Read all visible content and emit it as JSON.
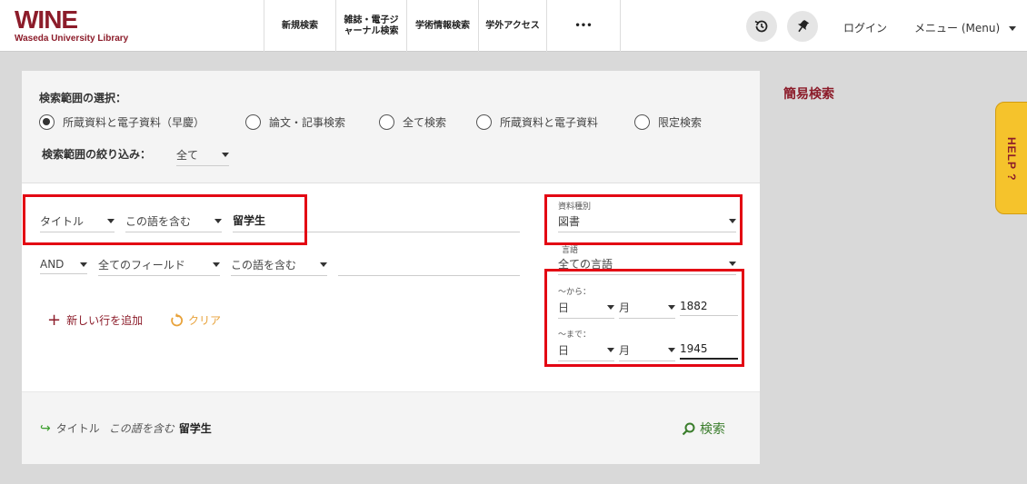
{
  "header": {
    "logo_main": "WINE",
    "logo_sub": "Waseda University Library",
    "nav": [
      {
        "label": "新規検索"
      },
      {
        "label": "雑誌・電子ジャーナル検索"
      },
      {
        "label": "学術情報検索"
      },
      {
        "label": "学外アクセス"
      },
      {
        "label": "•••"
      }
    ],
    "icons": {
      "history": "history-icon",
      "pin": "pin-icon"
    },
    "login": "ログイン",
    "menu": "メニュー (Menu)"
  },
  "scope": {
    "title": "検索範囲の選択：",
    "options": [
      {
        "label": "所蔵資料と電子資料（早慶）",
        "selected": true
      },
      {
        "label": "論文・記事検索",
        "selected": false
      },
      {
        "label": "全て検索",
        "selected": false
      },
      {
        "label": "所蔵資料と電子資料",
        "selected": false
      },
      {
        "label": "限定検索",
        "selected": false
      }
    ],
    "narrow_label": "検索範囲の絞り込み：",
    "narrow_value": "全て"
  },
  "query": {
    "row1": {
      "field": "タイトル",
      "operator": "この語を含む",
      "value": "留学生"
    },
    "row2": {
      "bool": "AND",
      "field": "全てのフィールド",
      "operator": "この語を含む",
      "value": ""
    },
    "add_row": "新しい行を追加",
    "clear": "クリア"
  },
  "filters": {
    "material_label": "資料種別",
    "material_value": "図書",
    "language_label": "言語",
    "language_value": "全ての言語",
    "from_label": "〜から：",
    "from": {
      "day": "日",
      "month": "月",
      "year": "1882"
    },
    "to_label": "〜まで：",
    "to": {
      "day": "日",
      "month": "月",
      "year": "1945"
    }
  },
  "summary": {
    "field": "タイトル",
    "operator": "この語を含む",
    "value": "留学生",
    "search": "検索"
  },
  "side": {
    "simple_search": "簡易検索",
    "help": "HELP ?"
  },
  "colors": {
    "brand": "#8c1c2a",
    "highlight": "#e30613",
    "accent": "#e8a23a",
    "search": "#3a7d2c"
  }
}
